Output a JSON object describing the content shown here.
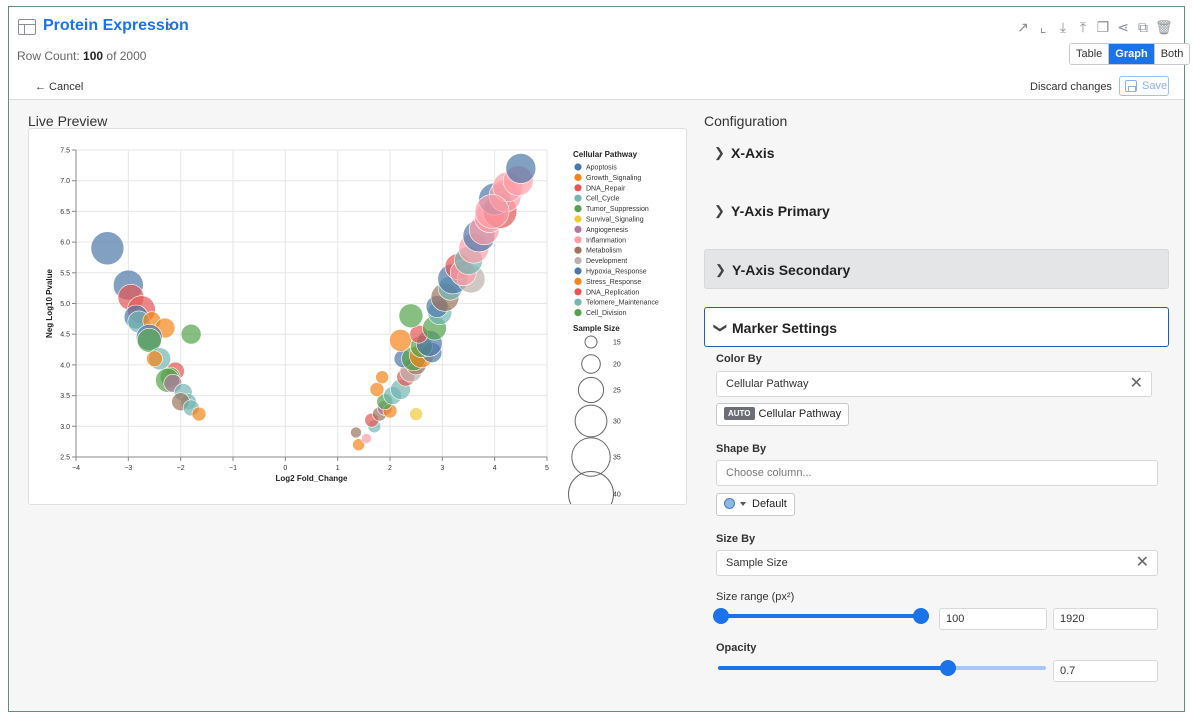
{
  "header": {
    "title": "Protein Expression",
    "title_chevron": "›",
    "row_count_prefix": "Row Count: ",
    "row_count_shown": "100",
    "row_count_suffix": " of 2000",
    "toolbar_icons": [
      "external-link-icon",
      "chart-icon",
      "download-icon",
      "upload-icon",
      "copy-icon",
      "share-icon",
      "duplicate-icon",
      "trash-icon"
    ],
    "view_modes": [
      "Table",
      "Graph",
      "Both"
    ],
    "active_view": "Graph"
  },
  "actions": {
    "cancel": "← Cancel",
    "discard": "Discard changes",
    "save": "Save"
  },
  "preview": {
    "title": "Live Preview"
  },
  "chart_data": {
    "type": "scatter",
    "xlabel": "Log2 Fold_Change",
    "ylabel": "Neg Log10 Pvalue",
    "xlim": [
      -4,
      5
    ],
    "ylim": [
      2.5,
      7.5
    ],
    "x_ticks": [
      -4,
      -3,
      -2,
      -1,
      0,
      1,
      2,
      3,
      4,
      5
    ],
    "y_ticks": [
      2.5,
      3.0,
      3.5,
      4.0,
      4.5,
      5.0,
      5.5,
      6.0,
      6.5,
      7.0,
      7.5
    ],
    "grid": true,
    "legend_color_title": "Cellular Pathway",
    "categories": [
      {
        "name": "Apoptosis",
        "color": "#4c78a8"
      },
      {
        "name": "Growth_Signaling",
        "color": "#f58518"
      },
      {
        "name": "DNA_Repair",
        "color": "#e45756"
      },
      {
        "name": "Cell_Cycle",
        "color": "#72b7b2"
      },
      {
        "name": "Tumor_Suppression",
        "color": "#54a24b"
      },
      {
        "name": "Survival_Signaling",
        "color": "#eeca3b"
      },
      {
        "name": "Angiogenesis",
        "color": "#b279a2"
      },
      {
        "name": "Inflammation",
        "color": "#ff9da6"
      },
      {
        "name": "Metabolism",
        "color": "#9d755d"
      },
      {
        "name": "Development",
        "color": "#bab0ac"
      },
      {
        "name": "Hypoxia_Response",
        "color": "#4c78a8"
      },
      {
        "name": "Stress_Response",
        "color": "#f58518"
      },
      {
        "name": "DNA_Replication",
        "color": "#e45756"
      },
      {
        "name": "Telomere_Maintenance",
        "color": "#72b7b2"
      },
      {
        "name": "Cell_Division",
        "color": "#54a24b"
      }
    ],
    "legend_size_title": "Sample Size",
    "size_legend": [
      15,
      20,
      25,
      30,
      35,
      40
    ],
    "opacity": 0.7,
    "points": [
      {
        "x": -3.4,
        "y": 5.9,
        "s": 33,
        "c": 0
      },
      {
        "x": -3.0,
        "y": 5.3,
        "s": 30,
        "c": 0
      },
      {
        "x": -2.95,
        "y": 5.1,
        "s": 26,
        "c": 2
      },
      {
        "x": -2.75,
        "y": 4.9,
        "s": 28,
        "c": 2
      },
      {
        "x": -2.85,
        "y": 4.78,
        "s": 24,
        "c": 0
      },
      {
        "x": -2.8,
        "y": 4.7,
        "s": 22,
        "c": 3
      },
      {
        "x": -2.55,
        "y": 4.72,
        "s": 18,
        "c": 1
      },
      {
        "x": -2.3,
        "y": 4.6,
        "s": 20,
        "c": 1
      },
      {
        "x": -2.6,
        "y": 4.45,
        "s": 26,
        "c": 0
      },
      {
        "x": -2.6,
        "y": 4.4,
        "s": 24,
        "c": 4
      },
      {
        "x": -1.8,
        "y": 4.5,
        "s": 20,
        "c": 4
      },
      {
        "x": -2.4,
        "y": 4.1,
        "s": 22,
        "c": 3
      },
      {
        "x": -2.5,
        "y": 4.1,
        "s": 16,
        "c": 1
      },
      {
        "x": -2.1,
        "y": 3.9,
        "s": 18,
        "c": 2
      },
      {
        "x": -2.2,
        "y": 3.8,
        "s": 20,
        "c": 4
      },
      {
        "x": -2.25,
        "y": 3.75,
        "s": 24,
        "c": 4
      },
      {
        "x": -2.15,
        "y": 3.7,
        "s": 18,
        "c": 6
      },
      {
        "x": -1.95,
        "y": 3.55,
        "s": 18,
        "c": 3
      },
      {
        "x": -1.85,
        "y": 3.4,
        "s": 16,
        "c": 3
      },
      {
        "x": -2.0,
        "y": 3.4,
        "s": 18,
        "c": 8
      },
      {
        "x": -1.8,
        "y": 3.3,
        "s": 16,
        "c": 3
      },
      {
        "x": -1.65,
        "y": 3.2,
        "s": 14,
        "c": 1
      },
      {
        "x": 1.4,
        "y": 2.7,
        "s": 12,
        "c": 1
      },
      {
        "x": 1.35,
        "y": 2.9,
        "s": 11,
        "c": 8
      },
      {
        "x": 1.55,
        "y": 2.8,
        "s": 10,
        "c": 7
      },
      {
        "x": 1.7,
        "y": 3.0,
        "s": 13,
        "c": 3
      },
      {
        "x": 1.65,
        "y": 3.1,
        "s": 14,
        "c": 2
      },
      {
        "x": 1.8,
        "y": 3.2,
        "s": 14,
        "c": 8
      },
      {
        "x": 1.9,
        "y": 3.3,
        "s": 15,
        "c": 6
      },
      {
        "x": 2.0,
        "y": 3.25,
        "s": 14,
        "c": 1
      },
      {
        "x": 2.5,
        "y": 3.2,
        "s": 13,
        "c": 5
      },
      {
        "x": 1.9,
        "y": 3.4,
        "s": 16,
        "c": 4
      },
      {
        "x": 2.05,
        "y": 3.5,
        "s": 18,
        "c": 3
      },
      {
        "x": 1.75,
        "y": 3.6,
        "s": 14,
        "c": 1
      },
      {
        "x": 2.2,
        "y": 3.6,
        "s": 20,
        "c": 3
      },
      {
        "x": 1.85,
        "y": 3.8,
        "s": 13,
        "c": 1
      },
      {
        "x": 2.3,
        "y": 3.8,
        "s": 18,
        "c": 2
      },
      {
        "x": 2.4,
        "y": 3.9,
        "s": 22,
        "c": 9
      },
      {
        "x": 2.5,
        "y": 4.0,
        "s": 20,
        "c": 8
      },
      {
        "x": 2.25,
        "y": 4.1,
        "s": 18,
        "c": 0
      },
      {
        "x": 2.45,
        "y": 4.1,
        "s": 24,
        "c": 4
      },
      {
        "x": 2.6,
        "y": 4.15,
        "s": 24,
        "c": 1
      },
      {
        "x": 2.8,
        "y": 4.2,
        "s": 20,
        "c": 0
      },
      {
        "x": 2.2,
        "y": 4.4,
        "s": 22,
        "c": 1
      },
      {
        "x": 2.6,
        "y": 4.3,
        "s": 22,
        "c": 4
      },
      {
        "x": 2.75,
        "y": 4.35,
        "s": 26,
        "c": 0
      },
      {
        "x": 2.55,
        "y": 4.5,
        "s": 18,
        "c": 2
      },
      {
        "x": 2.85,
        "y": 4.6,
        "s": 24,
        "c": 4
      },
      {
        "x": 2.4,
        "y": 4.8,
        "s": 24,
        "c": 4
      },
      {
        "x": 2.95,
        "y": 4.85,
        "s": 24,
        "c": 3
      },
      {
        "x": 2.9,
        "y": 4.95,
        "s": 22,
        "c": 0
      },
      {
        "x": 3.05,
        "y": 5.1,
        "s": 28,
        "c": 8
      },
      {
        "x": 3.15,
        "y": 5.25,
        "s": 24,
        "c": 3
      },
      {
        "x": 3.2,
        "y": 5.4,
        "s": 30,
        "c": 0
      },
      {
        "x": 3.3,
        "y": 5.6,
        "s": 26,
        "c": 2
      },
      {
        "x": 3.55,
        "y": 5.4,
        "s": 28,
        "c": 9
      },
      {
        "x": 3.4,
        "y": 5.5,
        "s": 26,
        "c": 7
      },
      {
        "x": 3.5,
        "y": 5.7,
        "s": 28,
        "c": 3
      },
      {
        "x": 3.6,
        "y": 5.9,
        "s": 30,
        "c": 7
      },
      {
        "x": 3.7,
        "y": 6.1,
        "s": 32,
        "c": 0
      },
      {
        "x": 3.8,
        "y": 6.2,
        "s": 30,
        "c": 7
      },
      {
        "x": 3.9,
        "y": 6.4,
        "s": 30,
        "c": 7
      },
      {
        "x": 4.1,
        "y": 6.5,
        "s": 34,
        "c": 2
      },
      {
        "x": 4.0,
        "y": 6.7,
        "s": 32,
        "c": 0
      },
      {
        "x": 4.2,
        "y": 6.75,
        "s": 32,
        "c": 7
      },
      {
        "x": 4.25,
        "y": 6.9,
        "s": 30,
        "c": 7
      },
      {
        "x": 4.45,
        "y": 7.0,
        "s": 30,
        "c": 7
      },
      {
        "x": 4.5,
        "y": 7.2,
        "s": 30,
        "c": 0
      },
      {
        "x": 3.95,
        "y": 6.5,
        "s": 34,
        "c": 7
      }
    ]
  },
  "config": {
    "title": "Configuration",
    "sections": {
      "x_axis": "X-Axis",
      "y_primary": "Y-Axis Primary",
      "y_secondary": "Y-Axis Secondary",
      "marker": "Marker Settings"
    },
    "color_by": {
      "label": "Color By",
      "value": "Cellular Pathway",
      "auto_badge": "AUTO",
      "auto_value": "Cellular Pathway"
    },
    "shape_by": {
      "label": "Shape By",
      "placeholder": "Choose column...",
      "shape_value": "Default"
    },
    "size_by": {
      "label": "Size By",
      "value": "Sample Size"
    },
    "size_range": {
      "label": "Size range (px²)",
      "min": "100",
      "max": "1920",
      "min_fraction": 0.0,
      "max_fraction": 1.0
    },
    "opacity": {
      "label": "Opacity",
      "value": "0.7",
      "fraction": 0.7
    }
  }
}
